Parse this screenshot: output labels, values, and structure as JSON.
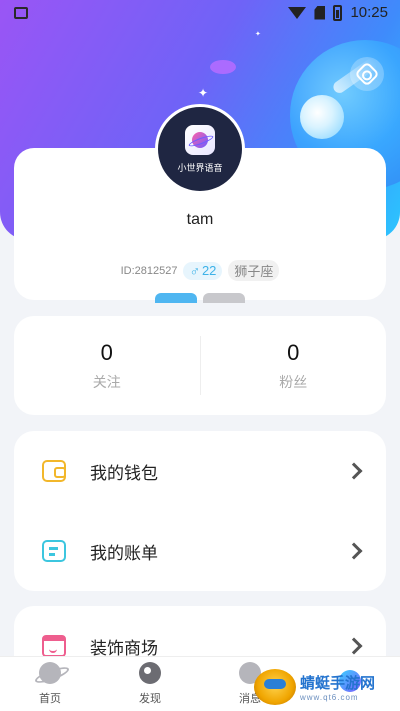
{
  "status_bar": {
    "time": "10:25"
  },
  "profile": {
    "avatar_text": "小世界语音",
    "username": "tam",
    "id_text": "ID:2812527",
    "gender_symbol": "♂",
    "age": "22",
    "zodiac": "狮子座"
  },
  "stats": [
    {
      "value": "0",
      "label": "关注"
    },
    {
      "value": "0",
      "label": "粉丝"
    }
  ],
  "menu": {
    "wallet": "我的钱包",
    "bill": "我的账单",
    "shop": "装饰商场"
  },
  "tabs": [
    {
      "label": "首页"
    },
    {
      "label": "发现"
    },
    {
      "label": "消息"
    },
    {
      "label": ""
    }
  ],
  "watermark": {
    "title": "蜻蜓手游网",
    "sub": "www.qt6.com"
  },
  "colors": {
    "gradient_start": "#9a55f5",
    "gradient_end": "#2bc6ff",
    "wallet": "#f2b72b",
    "bill": "#3cc6df",
    "shop": "#ee5e8e",
    "gender": "#3db2e8"
  }
}
